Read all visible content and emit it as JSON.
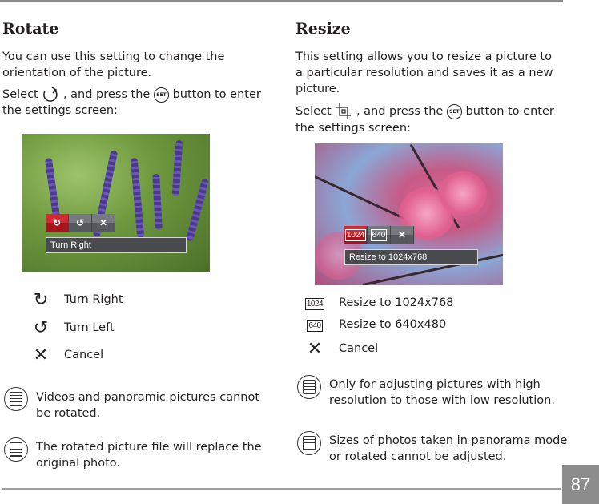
{
  "rotate": {
    "title": "Rotate",
    "intro_lines": [
      "You can use this setting to change the",
      "orientation of the picture."
    ],
    "select_prefix": "Select",
    "select_mid": ", and press the",
    "select_suffix": "button to enter",
    "select_line2": "the settings screen:",
    "set_button": "SET",
    "screen": {
      "buttons": [
        "turn-right",
        "turn-left",
        "cancel"
      ],
      "selected": 0,
      "caption": "Turn Right"
    },
    "options": [
      {
        "icon": "turn-right-icon",
        "label": "Turn Right"
      },
      {
        "icon": "turn-left-icon",
        "label": "Turn Left"
      },
      {
        "icon": "cancel-icon",
        "label": "Cancel"
      }
    ],
    "notes": [
      [
        "Videos and panoramic pictures cannot",
        "be rotated."
      ],
      [
        "The rotated picture file will replace the",
        "original photo."
      ]
    ]
  },
  "resize": {
    "title": "Resize",
    "intro_lines": [
      "This setting allows you to resize a picture to",
      "a particular resolution and saves it as a new",
      "picture."
    ],
    "select_prefix": "Select",
    "select_mid": ", and press the",
    "select_suffix": "button to enter",
    "select_line2": "the settings screen:",
    "set_button": "SET",
    "screen": {
      "buttons": [
        "1024",
        "640",
        "cancel"
      ],
      "selected": 0,
      "caption": "Resize to 1024x768"
    },
    "options": [
      {
        "icon": "1024",
        "label": "Resize to 1024x768"
      },
      {
        "icon": "640",
        "label": "Resize to 640x480"
      },
      {
        "icon": "cancel-icon",
        "label": "Cancel"
      }
    ],
    "notes": [
      [
        "Only for adjusting pictures with high",
        "resolution to those with low resolution."
      ],
      [
        "Sizes of photos taken in panorama mode",
        "or rotated cannot be adjusted."
      ]
    ]
  },
  "page_number": "87",
  "colors": {
    "selected_button": "#d12a33",
    "page_tab": "#8c8c8c"
  }
}
